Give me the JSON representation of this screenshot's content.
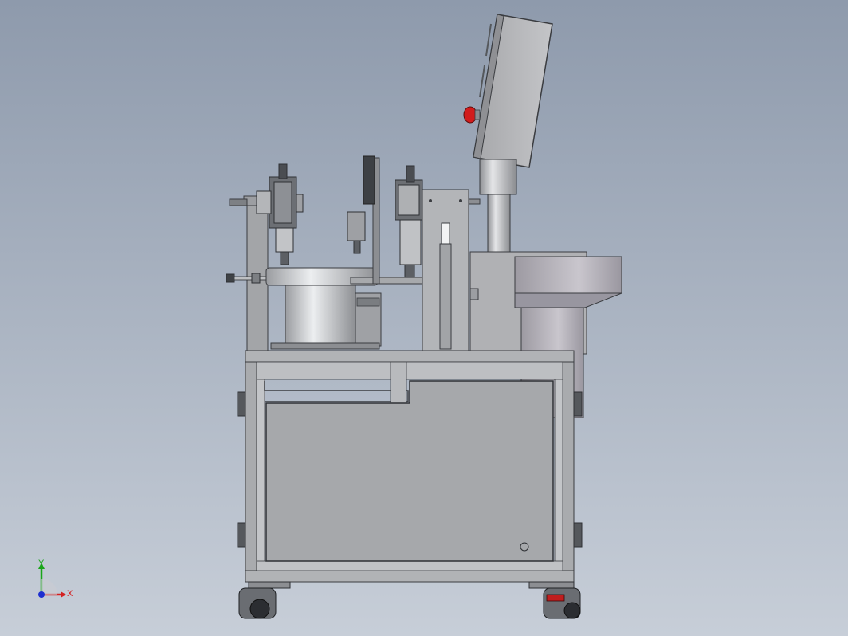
{
  "scene": {
    "background": {
      "top": "#8e9aac",
      "bottom": "#c7ced8"
    },
    "colors": {
      "frame": "#a9abae",
      "frame_dark": "#5a5d62",
      "panel": "#a6a8ab",
      "bowl": "#c3c5c8",
      "cabinet": "#b5b6b9",
      "hopper": "#a3a1a8",
      "estop": "#d21c1c",
      "edge": "#3a3c40"
    }
  },
  "triad": {
    "x_label": "X",
    "y_label": "Y",
    "z_label": "",
    "x_color": "#d42020",
    "y_color": "#1aa51a",
    "z_color": "#1e2fd0"
  }
}
